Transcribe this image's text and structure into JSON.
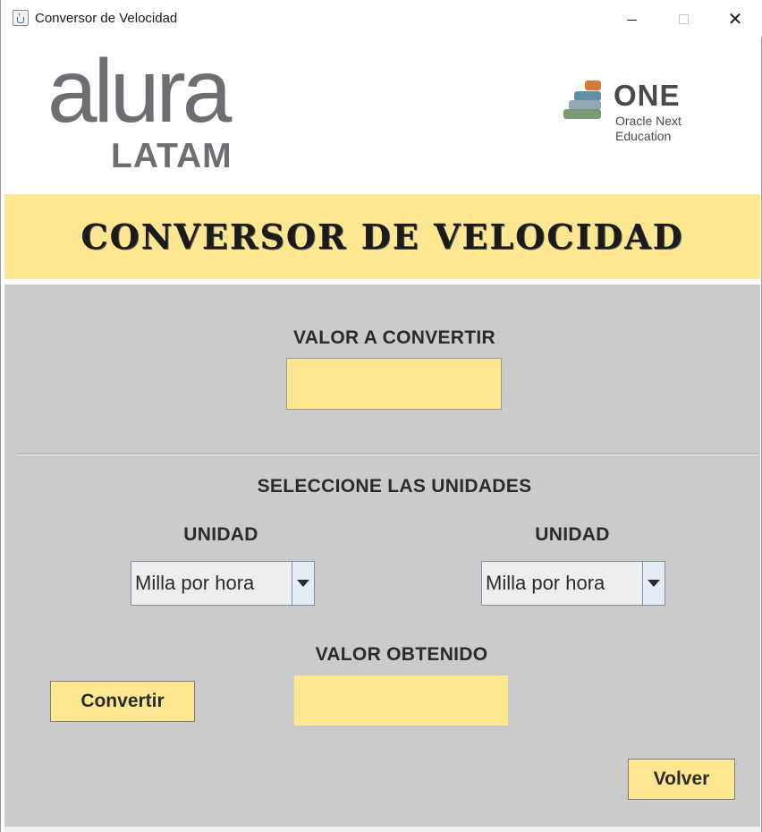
{
  "window": {
    "title": "Conversor de Velocidad",
    "icon": "java-cup-icon"
  },
  "header": {
    "alura_logo": {
      "main": "alura",
      "sub": "LATAM"
    },
    "one_logo": {
      "main": "ONE",
      "line1": "Oracle Next",
      "line2": "Education"
    }
  },
  "banner": {
    "title": "CONVERSOR DE VELOCIDAD"
  },
  "form": {
    "input_label": "VALOR A CONVERTIR",
    "input_value": "",
    "units_heading": "SELECCIONE LAS UNIDADES",
    "from_unit_label": "UNIDAD",
    "from_unit_value": "Milla por hora",
    "to_unit_label": "UNIDAD",
    "to_unit_value": "Milla por hora",
    "result_label": "VALOR OBTENIDO",
    "result_value": "",
    "convert_button": "Convertir",
    "back_button": "Volver"
  },
  "colors": {
    "accent_yellow": "#ffe791",
    "panel_grey": "#cbcbcb",
    "logo_grey": "#6d6e71"
  }
}
